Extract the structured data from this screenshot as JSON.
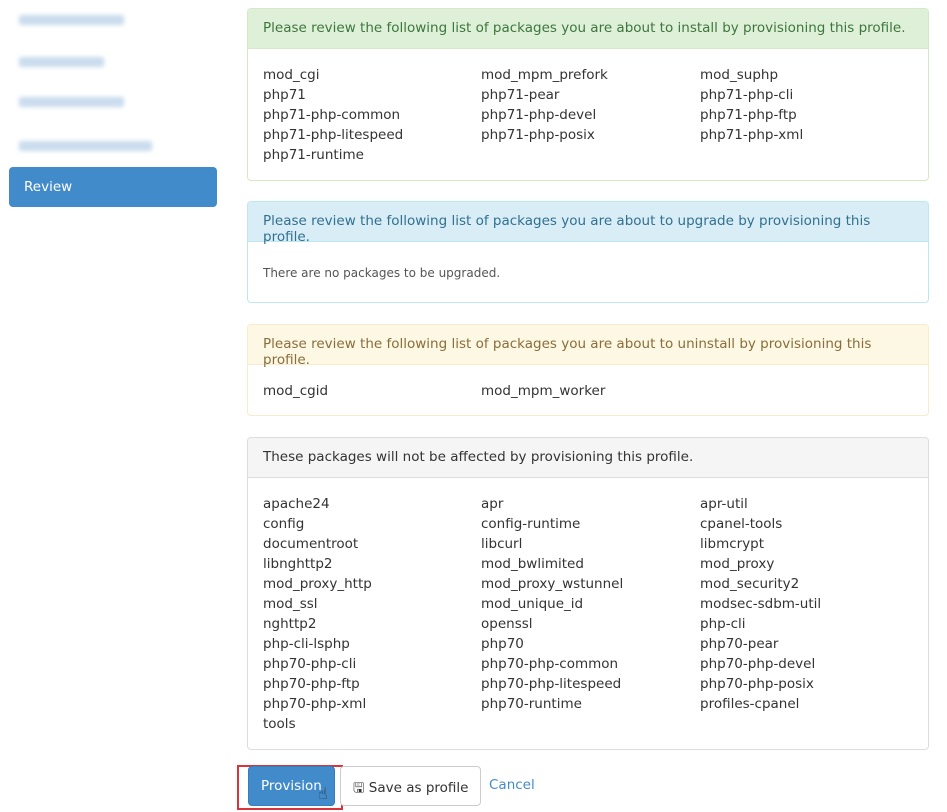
{
  "sidebar": {
    "active_item": "Review"
  },
  "install": {
    "header": "Please review the following list of packages you are about to install by provisioning this profile.",
    "packages": [
      "mod_cgi",
      "mod_mpm_prefork",
      "mod_suphp",
      "php71",
      "php71-pear",
      "php71-php-cli",
      "php71-php-common",
      "php71-php-devel",
      "php71-php-ftp",
      "php71-php-litespeed",
      "php71-php-posix",
      "php71-php-xml",
      "php71-runtime"
    ]
  },
  "upgrade": {
    "header": "Please review the following list of packages you are about to upgrade by provisioning this profile.",
    "message": "There are no packages to be upgraded."
  },
  "uninstall": {
    "header": "Please review the following list of packages you are about to uninstall by provisioning this profile.",
    "packages": [
      "mod_cgid",
      "mod_mpm_worker"
    ]
  },
  "unaffected": {
    "header": "These packages will not be affected by provisioning this profile.",
    "packages": [
      "apache24",
      "apr",
      "apr-util",
      "config",
      "config-runtime",
      "cpanel-tools",
      "documentroot",
      "libcurl",
      "libmcrypt",
      "libnghttp2",
      "mod_bwlimited",
      "mod_proxy",
      "mod_proxy_http",
      "mod_proxy_wstunnel",
      "mod_security2",
      "mod_ssl",
      "mod_unique_id",
      "modsec-sdbm-util",
      "nghttp2",
      "openssl",
      "php-cli",
      "php-cli-lsphp",
      "php70",
      "php70-pear",
      "php70-php-cli",
      "php70-php-common",
      "php70-php-devel",
      "php70-php-ftp",
      "php70-php-litespeed",
      "php70-php-posix",
      "php70-php-xml",
      "php70-runtime",
      "profiles-cpanel",
      "tools"
    ]
  },
  "actions": {
    "provision": "Provision",
    "save": "Save as profile",
    "cancel": "Cancel"
  }
}
